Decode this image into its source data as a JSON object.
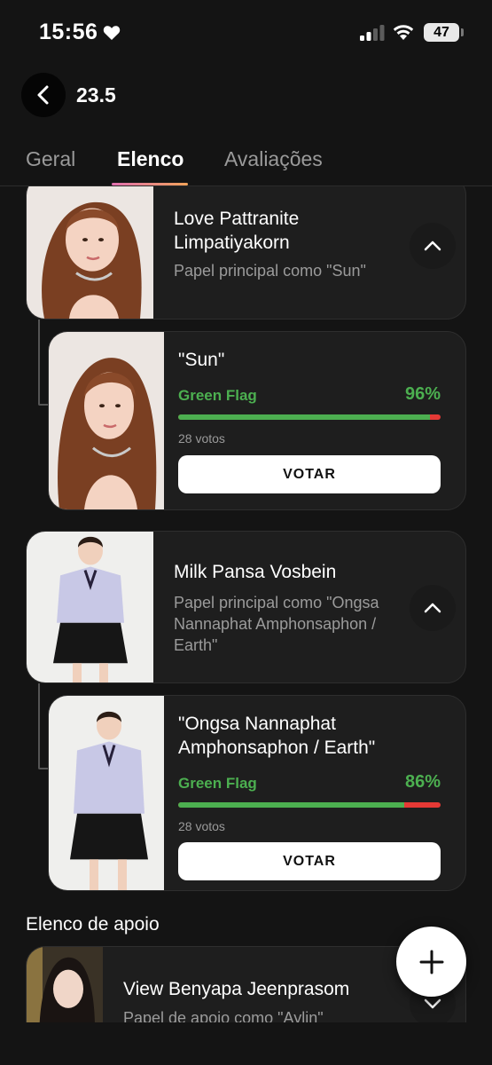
{
  "status_bar": {
    "time": "15:56",
    "battery": "47"
  },
  "header": {
    "title": "23.5"
  },
  "tabs": [
    {
      "label": "Geral"
    },
    {
      "label": "Elenco"
    },
    {
      "label": "Avaliações"
    }
  ],
  "active_tab": "Elenco",
  "colors": {
    "accent_green": "#4caf50",
    "accent_red": "#e53935",
    "tab_gradient_start": "#e06fae",
    "tab_gradient_end": "#f2a35a"
  },
  "main_cast": [
    {
      "actor": "Love Pattranite Limpatiyakorn",
      "role": "Papel principal como \"Sun\"",
      "character": {
        "name": "\"Sun\"",
        "flag_label": "Green Flag",
        "percent_text": "96%",
        "percent": 96,
        "votes": "28 votos",
        "vote_button": "VOTAR"
      }
    },
    {
      "actor": "Milk Pansa Vosbein",
      "role": "Papel principal como \"Ongsa Nannaphat Amphonsaphon / Earth\"",
      "character": {
        "name": "\"Ongsa Nannaphat Amphonsaphon / Earth\"",
        "flag_label": "Green Flag",
        "percent_text": "86%",
        "percent": 86,
        "votes": "28 votos",
        "vote_button": "VOTAR"
      }
    }
  ],
  "supporting": {
    "title": "Elenco de apoio",
    "items": [
      {
        "actor": "View Benyapa Jeenprasom",
        "role": "Papel de apoio como \"Aylin\""
      }
    ]
  }
}
